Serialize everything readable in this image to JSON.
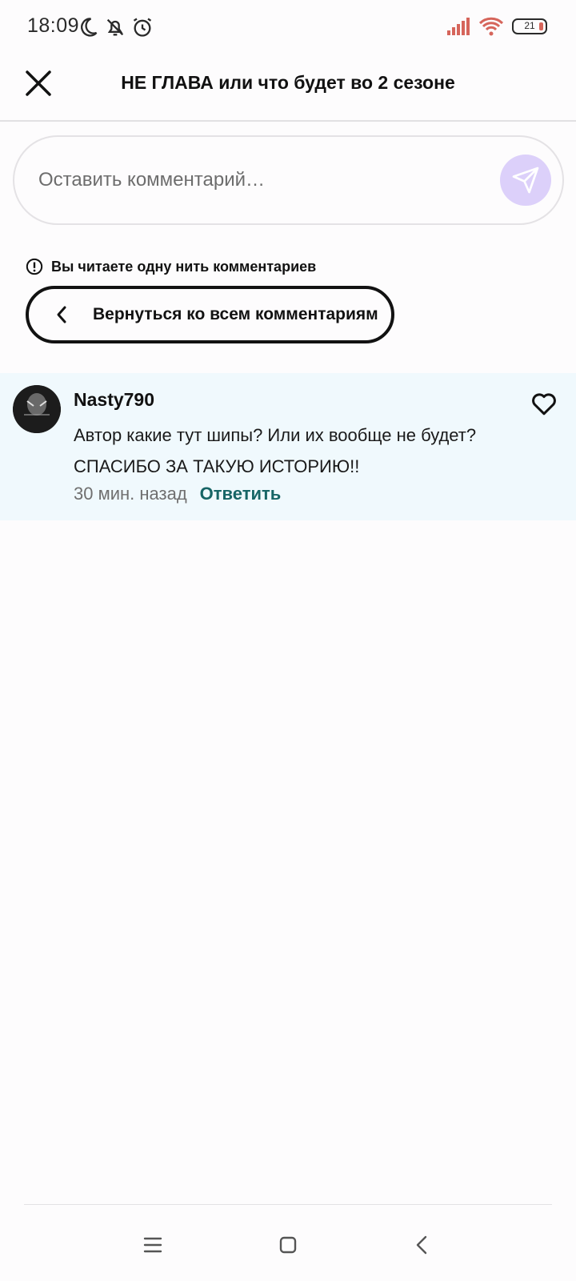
{
  "status_bar": {
    "time": "18:09",
    "battery": "21",
    "icons": [
      "moon-icon",
      "bell-off-icon",
      "alarm-icon",
      "signal-icon",
      "wifi-icon",
      "battery-icon"
    ]
  },
  "header": {
    "title": "НЕ ГЛАВА или что будет во 2 сезоне"
  },
  "comment_input": {
    "placeholder": "Оставить комментарий…"
  },
  "thread": {
    "note": "Вы читаете одну нить комментариев",
    "back_label": "Вернуться ко всем комментариям"
  },
  "comment": {
    "username": "Nasty790",
    "text": "Автор какие тут шипы? Или их вообще не будет? СПАСИБО ЗА ТАКУЮ ИСТОРИЮ!!",
    "time_ago": "30 мин. назад",
    "reply_label": "Ответить"
  },
  "colors": {
    "accent_teal": "#176566",
    "send_button": "#dcd0fa",
    "comment_bg": "#f0f9fd",
    "signal": "#d6655b"
  }
}
